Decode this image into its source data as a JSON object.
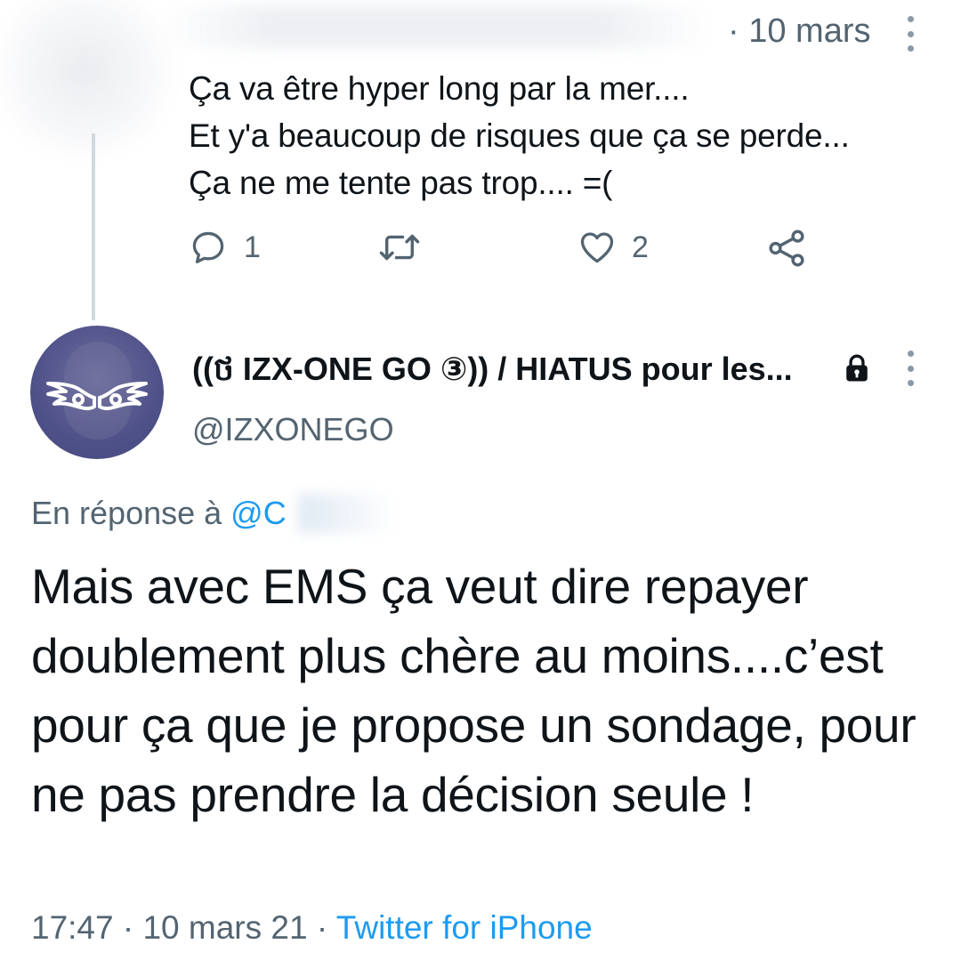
{
  "previous_tweet": {
    "time": "· 10 mars",
    "text": "Ça va être hyper long par la mer....\nEt y'a beaucoup de risques que ça se perde...\nÇa ne me tente pas trop.... =(",
    "actions": {
      "reply_icon": "reply-icon",
      "reply_count": "1",
      "retweet_icon": "retweet-icon",
      "like_icon": "heart-icon",
      "like_count": "2",
      "share_icon": "share-icon"
    },
    "more_icon": "more-vertical-icon"
  },
  "main_tweet": {
    "avatar_icon": "avatar-wings",
    "display_name": "((ថ IZX-ONE GO ③)) / HIATUS pour les...",
    "locked_icon": "lock-icon",
    "handle": "@IZXONEGO",
    "reply_prefix": "En réponse à",
    "reply_mention": "@C",
    "text": "Mais avec EMS ça veut dire repayer doublement plus chère au moins....c’est pour ça que je propose un sondage, pour ne pas prendre la décision seule !",
    "time": "17:47 · 10 mars 21 ·",
    "source": "Twitter for iPhone",
    "more_icon": "more-vertical-icon"
  },
  "colors": {
    "text": "#0f1419",
    "secondary": "#536471",
    "link": "#1d9bf0",
    "thread_line": "#cfd9de"
  }
}
